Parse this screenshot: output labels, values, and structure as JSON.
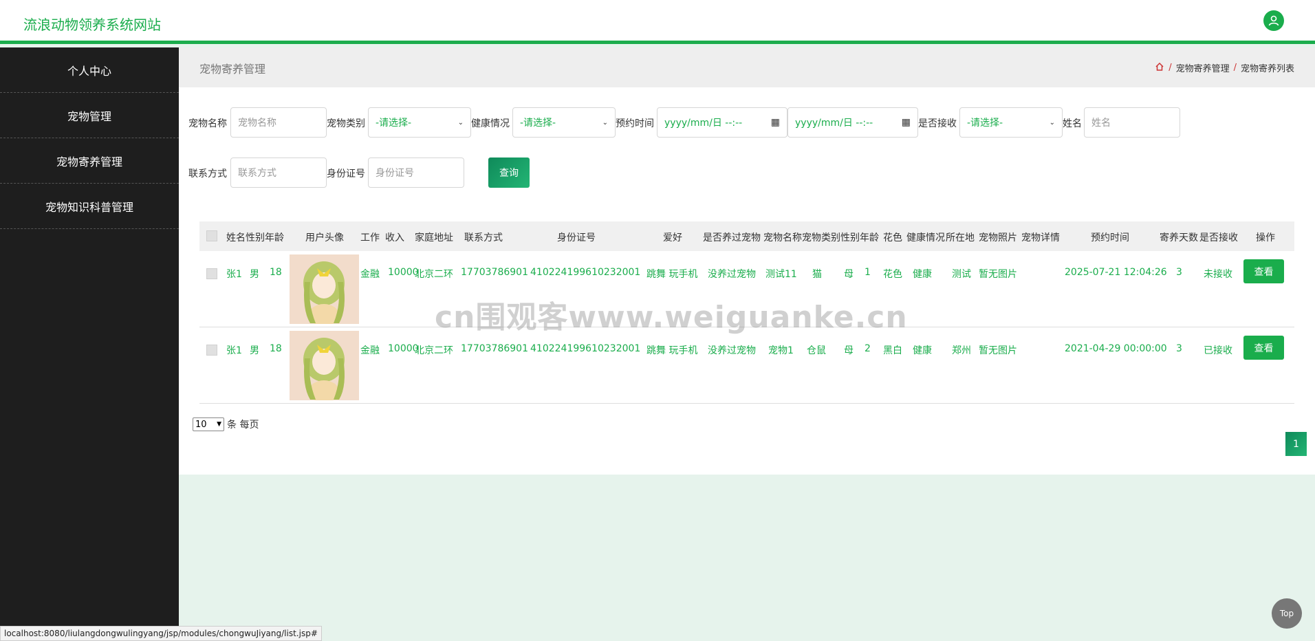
{
  "site_title": "流浪动物领养系统网站",
  "sidebar": {
    "items": [
      {
        "label": "个人中心"
      },
      {
        "label": "宠物管理"
      },
      {
        "label": "宠物寄养管理"
      },
      {
        "label": "宠物知识科普管理"
      }
    ]
  },
  "breadcrumb": {
    "title": "宠物寄养管理",
    "path": [
      "宠物寄养管理",
      "宠物寄养列表"
    ],
    "sep": "/"
  },
  "filters": {
    "pet_name_label": "宠物名称",
    "pet_name_ph": "宠物名称",
    "pet_type_label": "宠物类别",
    "pet_type_value": "-请选择-",
    "health_label": "健康情况",
    "health_value": "-请选择-",
    "time_label": "预约时间",
    "date_ph": "yyyy/mm/日 --:--",
    "accepted_label": "是否接收",
    "accepted_value": "-请选择-",
    "name_label": "姓名",
    "name_ph": "姓名",
    "contact_label": "联系方式",
    "contact_ph": "联系方式",
    "idcard_label": "身份证号",
    "idcard_ph": "身份证号",
    "search_label": "查询"
  },
  "table": {
    "headers": [
      "姓名",
      "性别",
      "年龄",
      "用户头像",
      "工作",
      "收入",
      "家庭地址",
      "联系方式",
      "身份证号",
      "爱好",
      "是否养过宠物",
      "宠物名称",
      "宠物类别",
      "性别",
      "年龄",
      "花色",
      "健康情况",
      "所在地",
      "宠物照片",
      "宠物详情",
      "预约时间",
      "寄养天数",
      "是否接收",
      "操作"
    ],
    "rows": [
      {
        "name": "张1",
        "gender": "男",
        "age": "18",
        "job": "金融",
        "income": "10000",
        "address": "北京二环",
        "phone": "17703786901",
        "idcard": "410224199610232001",
        "hobby": "跳舞 玩手机",
        "had_pet": "没养过宠物",
        "pet_name": "测试11",
        "pet_type": "猫",
        "pet_gender": "母",
        "pet_age": "1",
        "color": "花色",
        "health": "健康",
        "location": "测试",
        "photo": "暂无图片",
        "time": "2025-07-21 12:04:26",
        "days": "3",
        "accepted": "未接收",
        "action": "查看"
      },
      {
        "name": "张1",
        "gender": "男",
        "age": "18",
        "job": "金融",
        "income": "10000",
        "address": "北京二环",
        "phone": "17703786901",
        "idcard": "410224199610232001",
        "hobby": "跳舞 玩手机",
        "had_pet": "没养过宠物",
        "pet_name": "宠物1",
        "pet_type": "仓鼠",
        "pet_gender": "母",
        "pet_age": "2",
        "color": "黑白",
        "health": "健康",
        "location": "郑州",
        "photo": "暂无图片",
        "time": "2021-04-29 00:00:00",
        "days": "3",
        "accepted": "已接收",
        "action": "查看"
      }
    ]
  },
  "pager": {
    "size": "10",
    "size_suffix": "条 每页",
    "page": "1"
  },
  "status_url": "localhost:8080/liulangdongwulingyang/jsp/modules/chongwuJiyang/list.jsp#",
  "top_label": "Top",
  "watermark": "cn围观客www.weiguanke.cn",
  "colors": {
    "accent": "#1aad4c",
    "sidebar": "#1e1e1e"
  }
}
